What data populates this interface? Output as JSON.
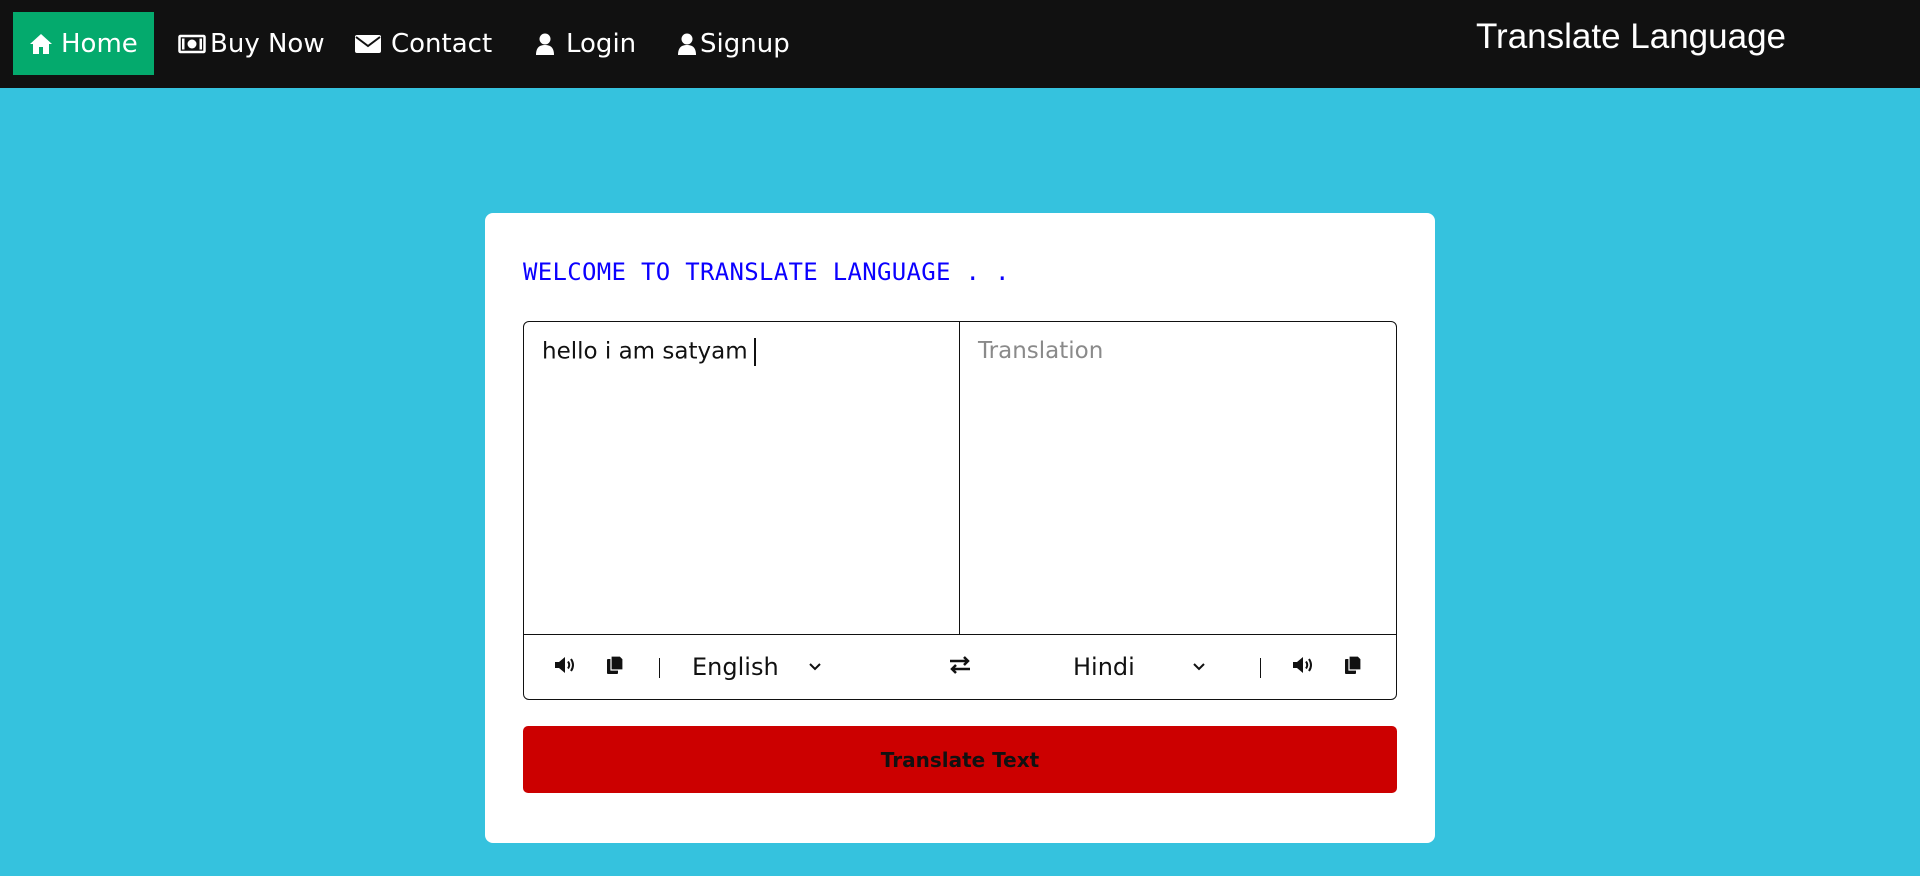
{
  "nav": {
    "home": {
      "label": "Home",
      "icon": "home-icon"
    },
    "buy_now": {
      "label": "Buy Now",
      "icon": "money-icon"
    },
    "contact": {
      "label": "Contact",
      "icon": "envelope-icon"
    },
    "login": {
      "label": "Login",
      "icon": "user-icon"
    },
    "signup": {
      "label": "Signup",
      "icon": "user-icon"
    },
    "brand": "Translate Language"
  },
  "card": {
    "welcome": "WELCOME TO TRANSLATE LANGUAGE . .",
    "from_text": "hello i am satyam",
    "to_placeholder": "Translation",
    "from_language": "English",
    "to_language": "Hindi",
    "button_label": "Translate Text"
  },
  "colors": {
    "background": "#35c2de",
    "navbar": "#111111",
    "active_nav": "#04aa6d",
    "welcome_text": "#0b00ff",
    "button": "#cc0000"
  }
}
